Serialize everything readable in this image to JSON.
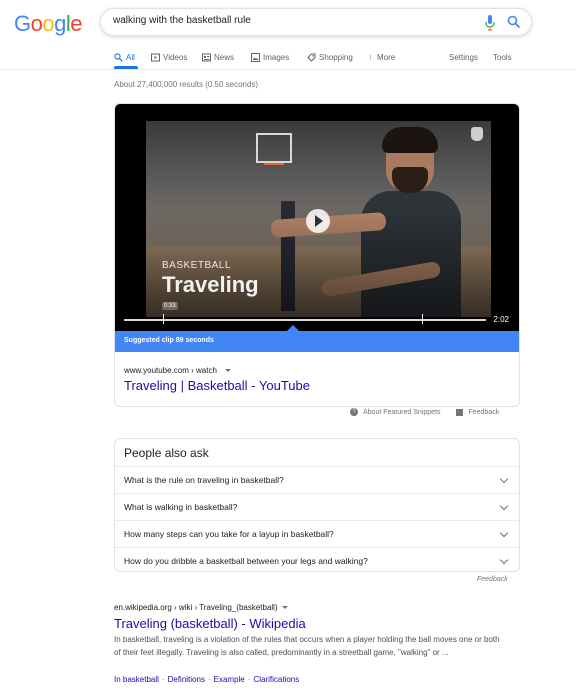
{
  "logo": {
    "text": [
      "G",
      "o",
      "o",
      "g",
      "l",
      "e"
    ],
    "colors": [
      "#4285f4",
      "#ea4335",
      "#fbbc05",
      "#4285f4",
      "#34a853",
      "#ea4335"
    ]
  },
  "search": {
    "query": "walking with the basketball rule"
  },
  "tabs": [
    {
      "label": "All",
      "icon": "search-icon"
    },
    {
      "label": "Videos",
      "icon": "video-icon"
    },
    {
      "label": "News",
      "icon": "news-icon"
    },
    {
      "label": "Images",
      "icon": "image-icon"
    },
    {
      "label": "Shopping",
      "icon": "tag-icon"
    },
    {
      "label": "More",
      "icon": "more-vert-icon"
    }
  ],
  "tools": {
    "settings": "Settings",
    "tools": "Tools"
  },
  "result_stats": "About 27,400,000 results (0.50 seconds)",
  "snippet": {
    "video_kicker": "BASKETBALL",
    "video_title": "Traveling",
    "clip_time": "0:33",
    "duration": "2:02",
    "clip_label": "Suggested clip 89 seconds",
    "url": "www.youtube.com › watch",
    "link": "Traveling | Basketball - YouTube",
    "footer_about": "About Featured Snippets",
    "footer_feedback": "Feedback"
  },
  "paa": {
    "title": "People also ask",
    "questions": [
      "What is the rule on traveling in basketball?",
      "What is walking in basketball?",
      "How many steps can you take for a layup in basketball?",
      "How do you dribble a basketball between your legs and walking?"
    ],
    "feedback": "Feedback"
  },
  "wiki": {
    "url": "en.wikipedia.org › wiki › Traveling_(basketball)",
    "title": "Traveling (basketball) - Wikipedia",
    "desc": "In basketball, traveling is a violation of the rules that occurs when a player holding the ball moves one or both of their feet illegally. Traveling is also called, predominantly in a streetball game, \"walking\" or ...",
    "links": [
      "In basketball",
      "Definitions",
      "Example",
      "Clarifications"
    ]
  },
  "colors": {
    "link": "#1a0dab",
    "accent": "#1a73e8",
    "clip_bar": "#4285f4"
  }
}
